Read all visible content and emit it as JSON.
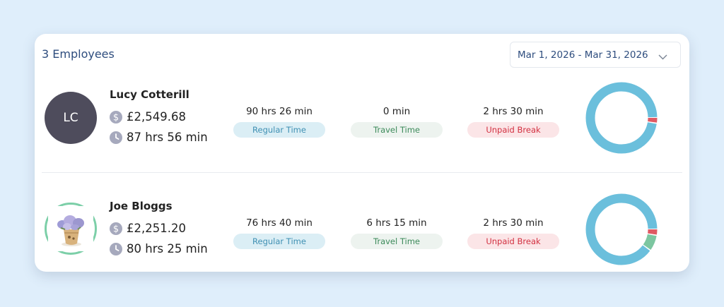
{
  "header": {
    "title": "3 Employees",
    "date_range": "Mar 1, 2026 - Mar 31, 2026"
  },
  "colors": {
    "regular": "#6bbfdc",
    "travel": "#7cc6a0",
    "unpaid": "#e05a63"
  },
  "employees": [
    {
      "name": "Lucy Cotterill",
      "initials": "LC",
      "pay": "£2,549.68",
      "hours": "87 hrs 56 min",
      "regular_time": "90 hrs 26 min",
      "regular_label": "Regular Time",
      "travel_time": "0 min",
      "travel_label": "Travel Time",
      "unpaid_break": "2 hrs 30 min",
      "unpaid_label": "Unpaid Break",
      "breakdown_minutes": {
        "regular": 5426,
        "travel": 0,
        "unpaid": 150
      }
    },
    {
      "name": "Joe Bloggs",
      "avatar": "flower-pot-photo",
      "pay": "£2,251.20",
      "hours": "80 hrs 25 min",
      "regular_time": "76 hrs 40 min",
      "regular_label": "Regular Time",
      "travel_time": "6 hrs 15 min",
      "travel_label": "Travel Time",
      "unpaid_break": "2 hrs 30 min",
      "unpaid_label": "Unpaid Break",
      "breakdown_minutes": {
        "regular": 4600,
        "travel": 375,
        "unpaid": 150
      }
    }
  ]
}
